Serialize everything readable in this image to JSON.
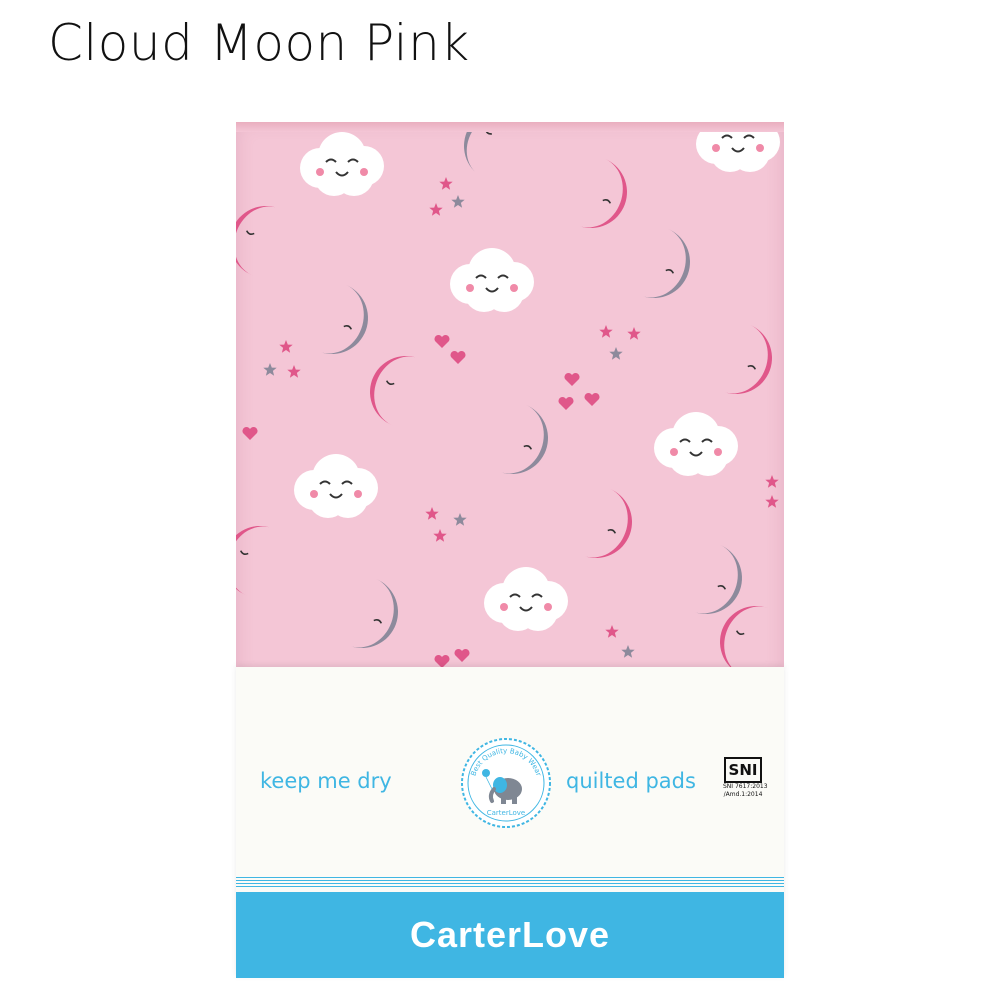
{
  "heading": {
    "title": "Cloud Moon Pink"
  },
  "product": {
    "fabric_pattern": "cloud-moon-star-heart print",
    "colors": {
      "fabric": "#f4c6d6",
      "moon_pink": "#e0578a",
      "moon_grey": "#8d8a9c",
      "cloud": "#ffffff",
      "accent_blue": "#3fb6e3"
    },
    "packaging": {
      "tagline_left": "keep me dry",
      "tagline_right": "quilted pads",
      "badge_ring_text": "Best Quality Baby Wear",
      "badge_brand": "CarterLove",
      "sni_mark": "SNI",
      "sni_line1": "SNI 7617:2013",
      "sni_line2": "/Amd.1:2014",
      "brand": "CarterLove"
    }
  }
}
